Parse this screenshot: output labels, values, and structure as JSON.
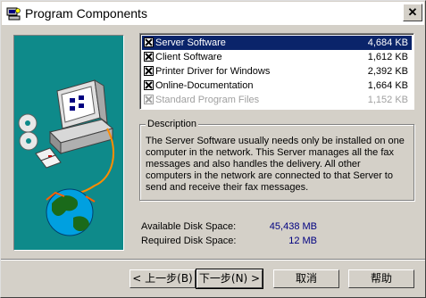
{
  "window": {
    "title": "Program Components",
    "close_label": "✕"
  },
  "components": [
    {
      "name": "Server Software",
      "size": "4,684 KB",
      "checked": true,
      "selected": true,
      "disabled": false
    },
    {
      "name": "Client Software",
      "size": "1,612 KB",
      "checked": true,
      "selected": false,
      "disabled": false
    },
    {
      "name": "Printer Driver for Windows",
      "size": "2,392 KB",
      "checked": true,
      "selected": false,
      "disabled": false
    },
    {
      "name": "Online-Documentation",
      "size": "1,664 KB",
      "checked": true,
      "selected": false,
      "disabled": false
    },
    {
      "name": "Standard Program Files",
      "size": "1,152 KB",
      "checked": true,
      "selected": false,
      "disabled": true
    }
  ],
  "description": {
    "title": "Description",
    "text": "The Server Software usually needs only be installed on one computer in the network. This Server manages all the fax messages and also handles the delivery. All other computers in the network are connected to that Server to send and receive their fax messages."
  },
  "disk": {
    "available_label": "Available Disk Space:",
    "available_value": "45,438 MB",
    "required_label": "Required Disk Space:",
    "required_value": "12 MB"
  },
  "buttons": {
    "back": "< 上一步(B)",
    "next": "下一步(N) >",
    "cancel": "取消",
    "help": "帮助"
  },
  "colors": {
    "selection": "#0a246a",
    "side_panel": "#0e8a8a",
    "disk_value": "#000080"
  }
}
